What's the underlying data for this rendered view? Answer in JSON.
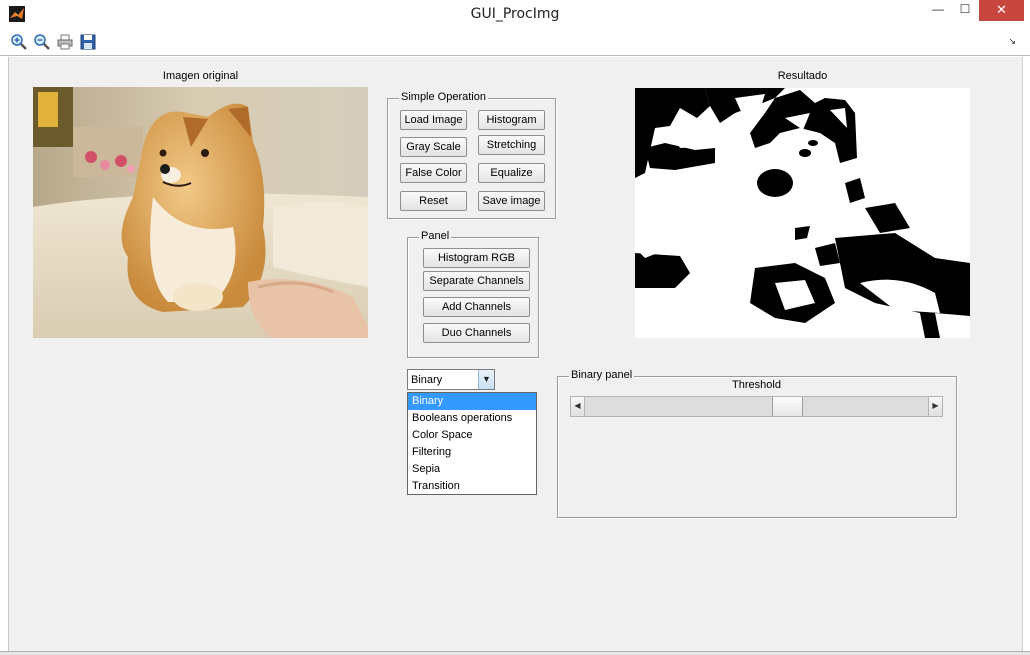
{
  "window": {
    "title": "GUI_ProcImg",
    "minimize_glyph": "—",
    "maximize_glyph": "☐",
    "close_glyph": "✕"
  },
  "toolbar": {
    "icons": [
      "zoom-in-icon",
      "zoom-out-icon",
      "print-icon",
      "save-icon"
    ],
    "dock_glyph": "↘"
  },
  "axes": {
    "original_label": "Imagen original",
    "result_label": "Resultado"
  },
  "simple_operation": {
    "title": "Simple Operation",
    "buttons": {
      "load_image": "Load Image",
      "histogram": "Histogram",
      "gray_scale": "Gray Scale",
      "stretching": "Stretching",
      "false_color": "False Color",
      "equalize": "Equalize",
      "reset": "Reset",
      "save_image": "Save image"
    }
  },
  "panel": {
    "title": "Panel",
    "buttons": {
      "histogram_rgb": "Histogram RGB",
      "separate_channels": "Separate Channels",
      "add_channels": "Add Channels",
      "duo_channels": "Duo Channels"
    }
  },
  "operation_select": {
    "selected": "Binary",
    "arrow_glyph": "▼",
    "options": [
      "Binary",
      "Booleans operations",
      "Color Space",
      "Filtering",
      "Sepia",
      "Transition"
    ]
  },
  "binary_panel": {
    "title": "Binary panel",
    "threshold_label": "Threshold",
    "slider_fraction": 0.6,
    "left_arrow": "◀",
    "right_arrow": "▶"
  },
  "colors": {
    "figure_bg": "#f0f0f0",
    "close_button": "#c7463f",
    "selection": "#3399ff"
  }
}
